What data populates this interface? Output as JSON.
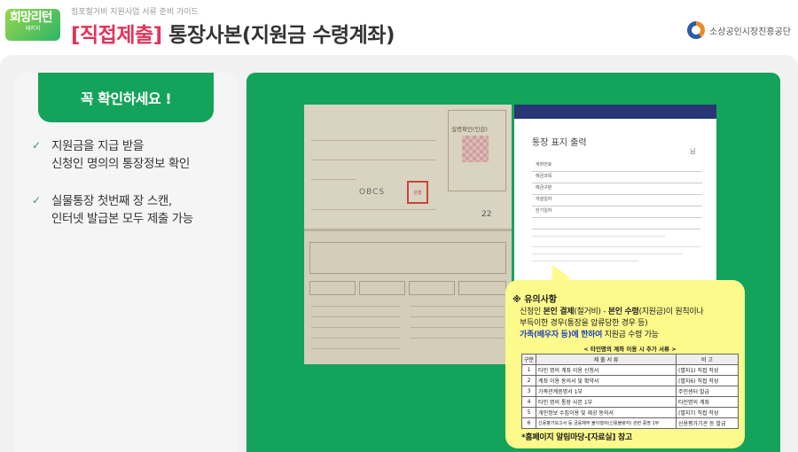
{
  "header": {
    "logo_main": "희망리턴",
    "logo_sub": "패키지",
    "breadcrumb": "점포철거비 지원사업 서류 준비 가이드",
    "title_accent": "[직접제출]",
    "title_rest": " 통장사본(지원금 수령계좌)",
    "org_name": "소상공인시장진흥공단"
  },
  "left": {
    "confirm_label": "꼭 확인하세요 !",
    "checks": [
      {
        "line1": "지원금을 지급 받을",
        "line2": "신청인 명의의 통장정보 확인"
      },
      {
        "line1": "실물통장 첫번째 장 스캔,",
        "line2": "인터넷 발급본 모두 제출 가능"
      }
    ]
  },
  "passbook": {
    "seal_label": "실명확인(인감)",
    "brand": "OBCS",
    "stamp": "은행",
    "number": "22"
  },
  "printdoc": {
    "title": "통장 표지 출력",
    "suffix": "님",
    "rows": [
      "계좌번호",
      "예금과목",
      "예금구분",
      "개설일자",
      "한기일자"
    ]
  },
  "notice": {
    "head": "※ 유의사항",
    "line1_a": "신청인 ",
    "line1_b": "본인 결제",
    "line1_c": "(철거비) - ",
    "line1_d": "본인 수령",
    "line1_e": "(지원금)이 원칙이나",
    "line2": "부득이한 경우(통장을 압류당한 경우 등)",
    "line3_a": "가족(배우자 등)에 한하여",
    "line3_b": " 지원금 수령 가능",
    "table_title": "< 타인명의 계좌 이용 시 추가 서류 >",
    "table_headers": [
      "구분",
      "제 출 서 류",
      "비 고"
    ],
    "table_rows": [
      [
        "1",
        "타인 명의 계좌 이용 신청서",
        "(별지1) 직접 작성"
      ],
      [
        "2",
        "계좌 이용 동의서 및 확약서",
        "(별지6) 직접 작성"
      ],
      [
        "3",
        "가족관계증명서 1부",
        "주민센터 발급"
      ],
      [
        "4",
        "타인 명의 통장 사본 1부",
        "타인명의 계좌"
      ],
      [
        "5",
        "개인정보 수집이용 및 제공 동의서",
        "(별지7) 직접 작성"
      ],
      [
        "6",
        "신용평가보고서 등 금융채무 불이행자(신용불량자) 관련 증명 1부",
        "신용평가기관 등 발급"
      ]
    ],
    "footer": "*홈페이지 알림마당-[자료실] 참고"
  }
}
